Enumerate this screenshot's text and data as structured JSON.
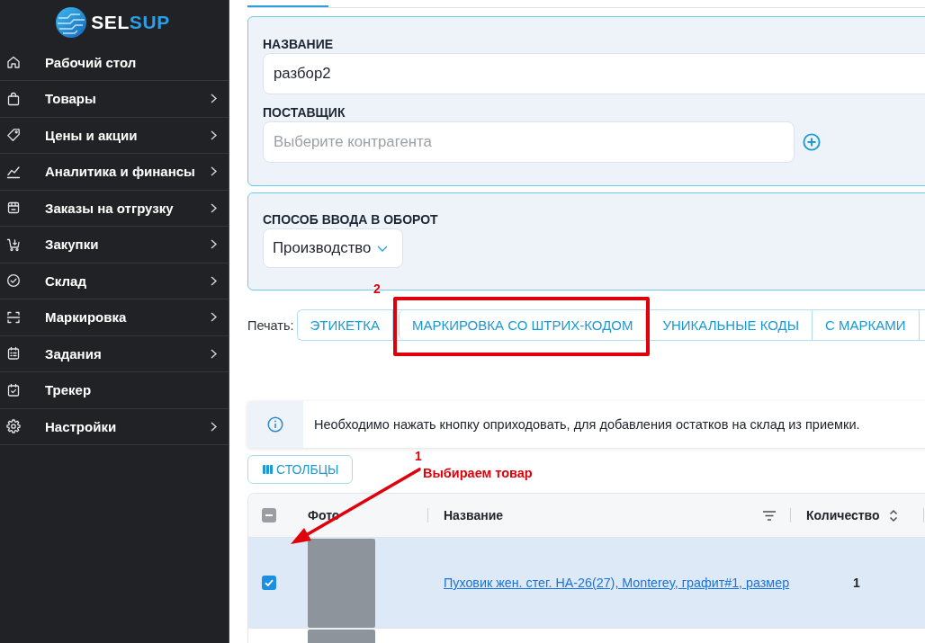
{
  "sidebar": {
    "logo": [
      {
        "text": "SEL",
        "accent": false
      },
      {
        "text": "SUP",
        "accent": true
      }
    ],
    "items": [
      {
        "label": "Рабочий стол",
        "has_submenu": false
      },
      {
        "label": "Товары",
        "has_submenu": true
      },
      {
        "label": "Цены и акции",
        "has_submenu": true
      },
      {
        "label": "Аналитика и финансы",
        "has_submenu": true
      },
      {
        "label": "Заказы на отгрузку",
        "has_submenu": true
      },
      {
        "label": "Закупки",
        "has_submenu": true
      },
      {
        "label": "Склад",
        "has_submenu": true
      },
      {
        "label": "Маркировка",
        "has_submenu": true
      },
      {
        "label": "Задания",
        "has_submenu": true
      },
      {
        "label": "Трекер",
        "has_submenu": false
      },
      {
        "label": "Настройки",
        "has_submenu": true
      }
    ]
  },
  "details_card": {
    "fields": [
      {
        "kind": "text",
        "label": "НАЗВАНИЕ",
        "value": "разбор2"
      },
      {
        "kind": "lookup",
        "label": "ПОСТАВЩИК",
        "placeholder": "Выберите контрагента"
      }
    ]
  },
  "circulation_card": {
    "fields": [
      {
        "kind": "select",
        "label": "СПОСОБ ВВОДА В ОБОРОТ",
        "value": "Производство"
      }
    ]
  },
  "print_bar": {
    "label": "Печать:",
    "buttons": [
      {
        "label": "ЭТИКЕТКА",
        "highlighted": false
      },
      {
        "label": "МАРКИРОВКА СО ШТРИХ-КОДОМ",
        "highlighted": true
      },
      {
        "label": "УНИКАЛЬНЫЕ КОДЫ",
        "highlighted": false
      },
      {
        "label": "С МАРКАМИ",
        "highlighted": false
      }
    ]
  },
  "notice": {
    "text": "Необходимо нажать кнопку оприходовать, для добавления остатков на склад из приемки."
  },
  "columns_button": {
    "label": "СТОЛБЦЫ"
  },
  "table": {
    "select_all": {
      "indeterminate": true
    },
    "columns": [
      {
        "kind": "photo",
        "label": "Фото"
      },
      {
        "kind": "name",
        "label": "Название",
        "filter": true
      },
      {
        "kind": "quantity",
        "label": "Количество",
        "sortable": true
      }
    ],
    "rows": [
      {
        "selected": true,
        "name": "Пуховик жен. стег. HA-26(27), Monterey, графит#1, размер",
        "quantity": "1"
      },
      {
        "selected": false
      }
    ]
  },
  "annotations": [
    {
      "kind": "step",
      "number": "2"
    },
    {
      "kind": "pointer",
      "number": "1",
      "text": "Выбираем товар"
    }
  ]
}
